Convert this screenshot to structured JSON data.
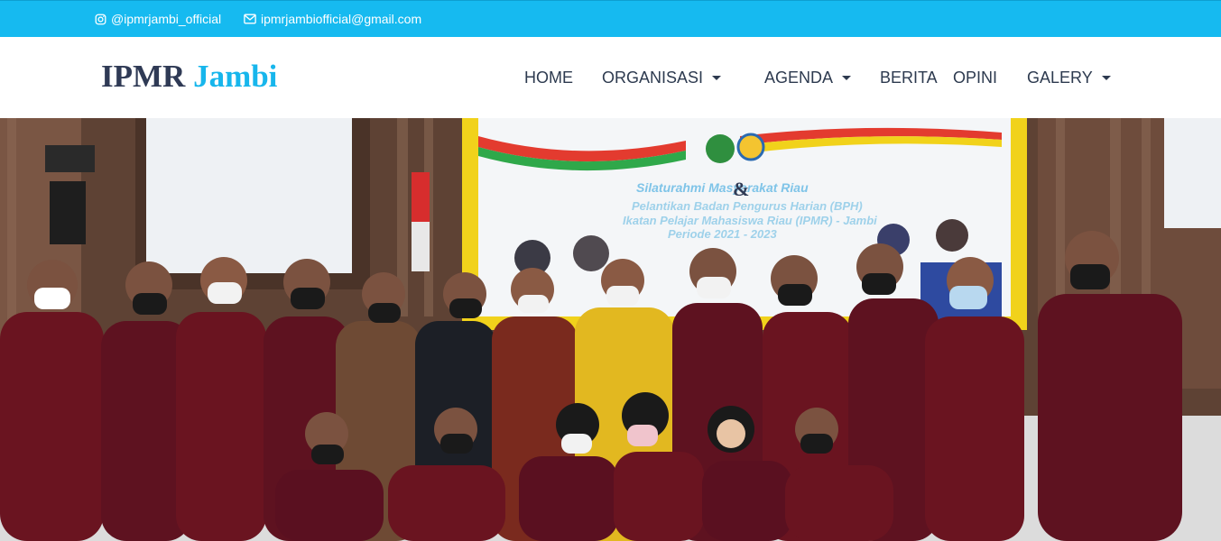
{
  "topbar": {
    "instagram": {
      "icon": "instagram-icon",
      "label": "@ipmrjambi_official"
    },
    "email": {
      "icon": "envelope-icon",
      "label": "ipmrjambiofficial@gmail.com"
    }
  },
  "brand": {
    "part1": "IPMR",
    "part2": "Jambi"
  },
  "nav": [
    {
      "label": "HOME",
      "dropdown": false
    },
    {
      "label": "ORGANISASI",
      "dropdown": true
    },
    {
      "label": "AGENDA",
      "dropdown": true
    },
    {
      "label": "BERITA",
      "dropdown": false
    },
    {
      "label": "OPINI",
      "dropdown": false
    },
    {
      "label": "GALERY",
      "dropdown": true
    }
  ],
  "hero": {
    "banner": {
      "line1": "Silaturahmi Masyarakat Riau",
      "amp": "&",
      "line2": "Pelantikan Badan Pengurus Harian (BPH)",
      "line3": "Ikatan Pelajar Mahasiswa Riau (IPMR) - Jambi",
      "line4": "Periode 2021 - 2023"
    }
  },
  "colors": {
    "accent": "#16baf0",
    "nav_text": "#2d3a4f",
    "brand_dark": "#2f3a55"
  }
}
